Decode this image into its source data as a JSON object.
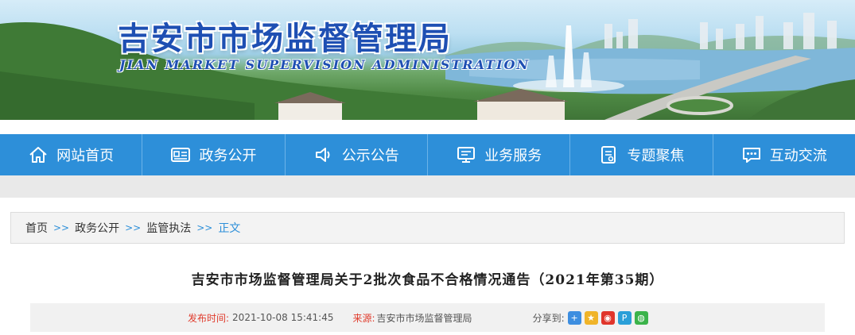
{
  "banner": {
    "title": "吉安市市场监督管理局",
    "subtitle": "JIAN  MARKET  SUPERVISION  ADMINISTRATION"
  },
  "nav": {
    "items": [
      {
        "label": "网站首页",
        "icon": "home-icon"
      },
      {
        "label": "政务公开",
        "icon": "id-card-icon"
      },
      {
        "label": "公示公告",
        "icon": "speaker-icon"
      },
      {
        "label": "业务服务",
        "icon": "monitor-icon"
      },
      {
        "label": "专题聚焦",
        "icon": "document-icon"
      },
      {
        "label": "互动交流",
        "icon": "chat-bubble-icon"
      }
    ]
  },
  "breadcrumb": {
    "items": [
      "首页",
      "政务公开",
      "监管执法"
    ],
    "separator": ">>",
    "current": "正文"
  },
  "article": {
    "title": "吉安市市场监督管理局关于2批次食品不合格情况通告（2021年第35期）",
    "published_label": "发布时间:",
    "published_value": "2021-10-08 15:41:45",
    "source_label": "来源:",
    "source_value": "吉安市市场监督管理局",
    "share_label": "分享到:"
  },
  "share_icons": [
    {
      "name": "share-more-icon",
      "color": "#3d8ee0"
    },
    {
      "name": "share-qzone-icon",
      "color": "#f0b429"
    },
    {
      "name": "share-weibo-icon",
      "color": "#e0352b"
    },
    {
      "name": "share-tencent-icon",
      "color": "#2a9fd8"
    },
    {
      "name": "share-wechat-icon",
      "color": "#3bb34a"
    }
  ],
  "colors": {
    "nav_bg": "#2d8fd9",
    "title_blue": "#1e4fb3",
    "accent_red": "#e03c2d"
  }
}
